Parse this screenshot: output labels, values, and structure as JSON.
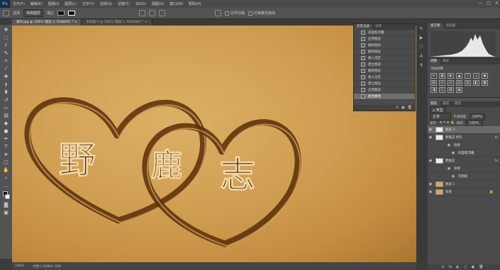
{
  "app": {
    "logo": "Ps"
  },
  "menu": [
    "文件(F)",
    "编辑(E)",
    "图像(I)",
    "图层(L)",
    "文字(Y)",
    "选择(S)",
    "滤镜(T)",
    "3D(D)",
    "视图(V)",
    "窗口(W)",
    "帮助(H)"
  ],
  "window_controls": [
    "—",
    "□",
    "✕"
  ],
  "options": {
    "mode_label": "选择",
    "mode_value": "填相图层",
    "stroke_label": "描边",
    "align_label": "对齐边缘",
    "constrain_label": "约束路径拖动"
  },
  "tabs": [
    {
      "label": "素材.jpg @ 100% (图层 2, RGB/8#) *",
      "close": "×"
    },
    {
      "label": "未标题-1 @ 100% (图层 1, RGB/8#) *",
      "close": "×"
    }
  ],
  "canvas_text": [
    "野",
    "鹿",
    "志"
  ],
  "status": {
    "zoom": "100%",
    "doc": "文档:1.63M/6.16M"
  },
  "history": {
    "tabs": [
      "历史记录",
      "动作"
    ],
    "items": [
      "斜面和浮雕",
      "启用图层",
      "删除图层",
      "删除图层",
      "载入选区",
      "建立图层",
      "删除图层",
      "载入选区",
      "建立图层",
      "启用图层",
      "复合路径"
    ],
    "selected_index": 10,
    "footer_icons": [
      "⊡",
      "▣",
      "🗑"
    ]
  },
  "histogram": {
    "tabs": [
      "直方图",
      "导航器"
    ]
  },
  "adjustments": {
    "tabs": [
      "调整",
      "样式"
    ],
    "title": "添加调整",
    "icons": [
      "☀",
      "▦",
      "◐",
      "▲",
      "▽",
      "◇",
      "◆",
      "▨",
      "◎",
      "⚖",
      "▤",
      "▥",
      "◧",
      "▩",
      "◨",
      "◫",
      "▧",
      "▦"
    ]
  },
  "layers": {
    "tabs": [
      "图层",
      "通道",
      "路径"
    ],
    "kind_label": "ρ 类型",
    "blend_mode": "正常",
    "opacity_label": "不透明度:",
    "opacity_value": "100%",
    "lock_label": "锁定:",
    "fill_label": "填充:",
    "fill_value": "100%",
    "rows": [
      {
        "name": "图层 3",
        "type": "layer",
        "thumb": "check",
        "selected": true
      },
      {
        "name": "野鹿志 拷贝",
        "type": "layer",
        "thumb": "check",
        "fx": "fx"
      },
      {
        "name": "效果",
        "type": "sub"
      },
      {
        "name": "斜面和浮雕",
        "type": "subsub"
      },
      {
        "name": "野鹿志",
        "type": "layer",
        "thumb": "check",
        "fx": "fx"
      },
      {
        "name": "效果",
        "type": "sub"
      },
      {
        "name": "内阴影",
        "type": "subsub"
      },
      {
        "name": "图层 1",
        "type": "layer",
        "thumb": "sand"
      },
      {
        "name": "背景",
        "type": "layer",
        "thumb": "sand",
        "locked": true
      }
    ],
    "footer_icons": [
      "⊝",
      "fx",
      "◐",
      "▢",
      "▣",
      "🗑"
    ]
  },
  "colors": {
    "accent_selected": "#6f6f6f",
    "sand_light": "#e4b66a",
    "sand_dark": "#a8702a",
    "heart_groove": "#5a2d08"
  }
}
